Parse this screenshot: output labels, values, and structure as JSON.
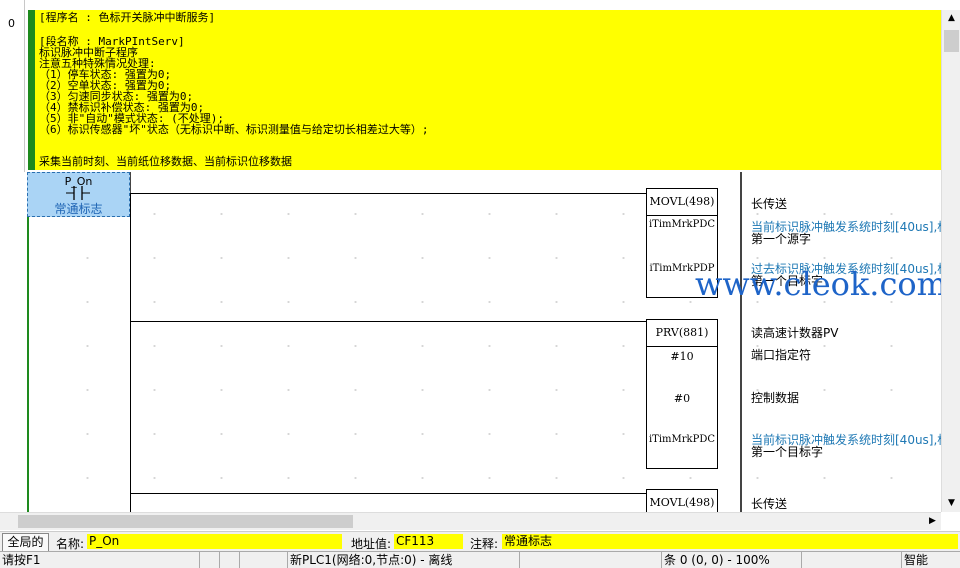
{
  "rung": {
    "number": "0"
  },
  "comment": {
    "lines": [
      "[程序名 : 色标开关脉冲中断服务]",
      "",
      "[段名称 : MarkPIntServ]",
      "标识脉冲中断子程序",
      "注意五种特殊情况处理:",
      "（1）停车状态: 强置为0;",
      "（2）空单状态: 强置为0;",
      "（3）匀速同步状态: 强置为0;",
      "（4）禁标识补偿状态: 强置为0;",
      "（5）非\"自动\"模式状态: (不处理);",
      "（6）标识传感器\"坏\"状态（无标识中断、标识测量值与给定切长相差过大等）;",
      "",
      "采集当前时刻、当前纸位移数据、当前标识位移数据"
    ]
  },
  "contact": {
    "name": "P_On",
    "comment": "常通标志"
  },
  "blocks": [
    {
      "instruction": "MOVL(498)",
      "operands": [
        "iTimMrkPDC",
        "iTimMrkPDP"
      ],
      "notes": [
        "长传送",
        "当前标识脉冲触发系统时刻[40us],标",
        "第一个源字",
        "过去标识脉冲触发系统时刻[40us],标",
        "第一个目标字"
      ]
    },
    {
      "instruction": "PRV(881)",
      "operands": [
        "#10",
        "#0",
        "iTimMrkPDC"
      ],
      "notes": [
        "读高速计数器PV",
        "端口指定符",
        "控制数据",
        "当前标识脉冲触发系统时刻[40us],标",
        "第一个目标字"
      ]
    },
    {
      "instruction": "MOVL(498)",
      "operands": [],
      "notes": [
        "长传送"
      ]
    }
  ],
  "infobar": {
    "tab_label": "全局的",
    "name_label": "名称:",
    "name_value": "P_On",
    "address_label": "地址值:",
    "address_value": "CF113",
    "comment_label": "注释:",
    "comment_value": "常通标志"
  },
  "statusbar": {
    "help": "请按F1",
    "plc": "新PLC1(网络:0,节点:0) - 离线",
    "position": "条 0 (0, 0)  - 100%",
    "mode": "智能"
  },
  "watermark": "www.cleok.com"
}
